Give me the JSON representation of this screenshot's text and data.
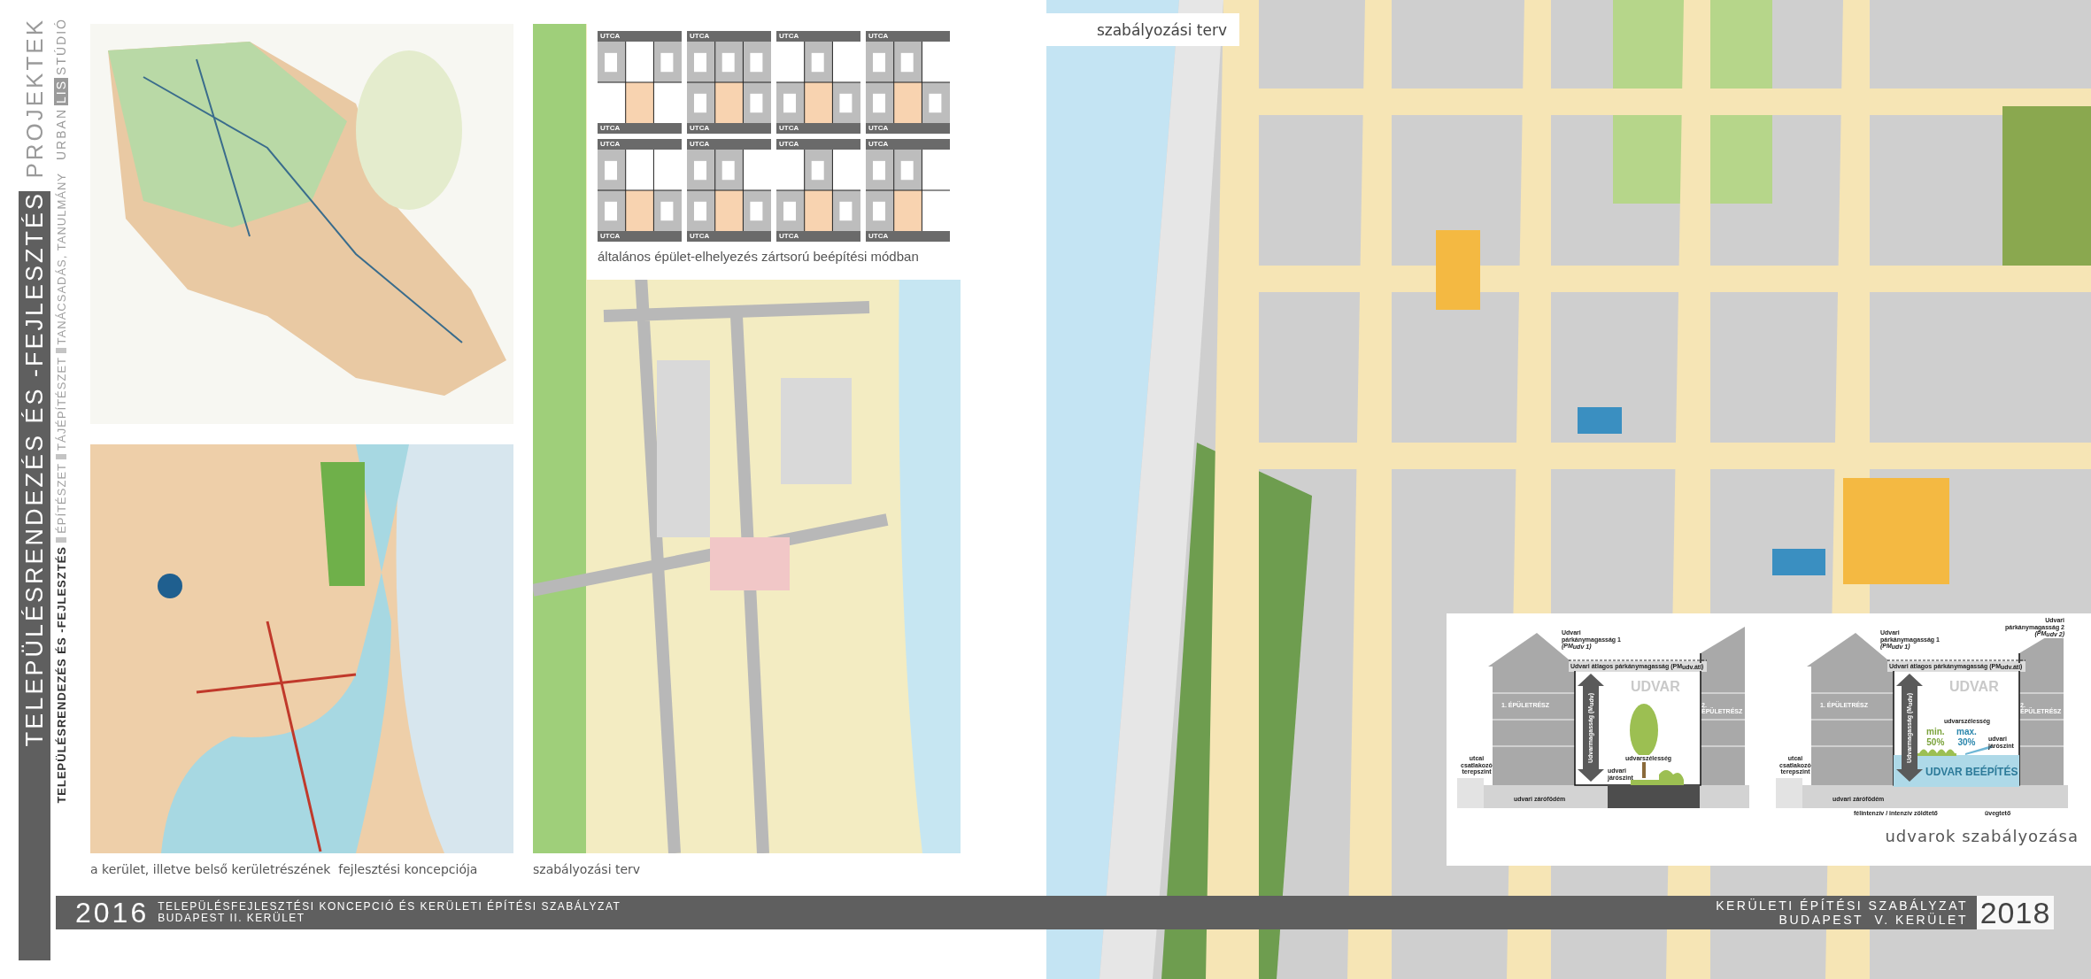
{
  "sidebar": {
    "section": "PROJEKTEK",
    "studio": {
      "start": "URBAN",
      "highlight": "LIS",
      "end": "STÚDIÓ"
    },
    "band_title": "TELEPÜLÉSRENDEZÉS ÉS -FEJLESZTÉS",
    "categories": [
      {
        "label": "TELEPÜLÉSRENDEZÉS ÉS -FEJLESZTÉS",
        "selected": true
      },
      {
        "label": "ÉPÍTÉSZET",
        "selected": false
      },
      {
        "label": "TÁJÉPÍTÉSZET",
        "selected": false
      },
      {
        "label": "TANÁCSADÁS, TANULMÁNY",
        "selected": false
      }
    ]
  },
  "left_page": {
    "block_diagrams": {
      "panels": [
        {
          "top_label": "UTCA",
          "bottom_label": "UTCA"
        },
        {
          "top_label": "UTCA",
          "bottom_label": "UTCA"
        },
        {
          "top_label": "UTCA",
          "bottom_label": "UTCA"
        },
        {
          "top_label": "UTCA",
          "bottom_label": "UTCA"
        },
        {
          "top_label": "UTCA",
          "bottom_label": "UTCA"
        },
        {
          "top_label": "UTCA",
          "bottom_label": "UTCA"
        },
        {
          "top_label": "UTCA",
          "bottom_label": "UTCA"
        },
        {
          "top_label": "UTCA",
          "bottom_label": "UTCA"
        }
      ],
      "caption": "általános épület-elhelyezés zártsorú beépítési módban"
    },
    "captions": [
      "a kerület, illetve belső kerületrészének  fejlesztési koncepciója",
      "szabályozási terv"
    ]
  },
  "right_page": {
    "map_label": "szabályozási terv",
    "courtyard_sections": {
      "caption": "udvarok szabályozása",
      "diagrams": [
        {
          "kind": "green",
          "left_part": "1. ÉPÜLETRÉSZ",
          "right_part": "2. ÉPÜLETRÉSZ",
          "courtyard": "UDVAR",
          "cornice_labels": [
            "Udvari párkánymagasság 1 *(PM$_{udv 1}$)*"
          ],
          "average_label": "Udvari átlagos párkánymagasság (PM$_{udv.átl}$)",
          "height_label": "Udvarmagasság (M$_{udv}$)",
          "width_label": "udvarszélesség",
          "floor_label": "udvari járószint",
          "slab_label": "udvari zárófödém",
          "street_label": "utcai csatlakozó terepszint"
        },
        {
          "kind": "built",
          "left_part": "1. ÉPÜLETRÉSZ",
          "right_part": "2. ÉPÜLETRÉSZ",
          "courtyard": "UDVAR",
          "cornice_labels": [
            "Udvari párkánymagasság 1 *(PM$_{udv 1}$)*",
            "Udvari párkánymagasság 2 *(PM$_{udv 2}$)*"
          ],
          "average_label": "Udvari átlagos párkánymagasság (PM$_{udv.átl}$)",
          "height_label": "Udvarmagasság (M$_{udv}$)",
          "width_label": "udvarszélesség",
          "floor_label": "udvari járószint",
          "slab_label": "udvari zárófödém",
          "street_label": "utcai csatlakozó terepszint",
          "built_label": "UDVAR BEÉPÍTÉS",
          "green_share": {
            "label": "min.",
            "value": "50%"
          },
          "glass_share": {
            "label": "max.",
            "value": "30%"
          },
          "green_roof_label": "félintenzív / intenzív zöldtető",
          "glass_roof_label": "üvegtető"
        }
      ]
    }
  },
  "footer": {
    "left": {
      "year": "2016",
      "lines": [
        "TELEPÜLÉSFEJLESZTÉSI KONCEPCIÓ ÉS KERÜLETI ÉPÍTÉSI SZABÁLYZAT",
        "BUDAPEST II. KERÜLET"
      ]
    },
    "right": {
      "lines": [
        "KERÜLETI ÉPÍTÉSI SZABÁLYZAT",
        "BUDAPEST  V. KERÜLET"
      ],
      "year": "2018"
    }
  }
}
